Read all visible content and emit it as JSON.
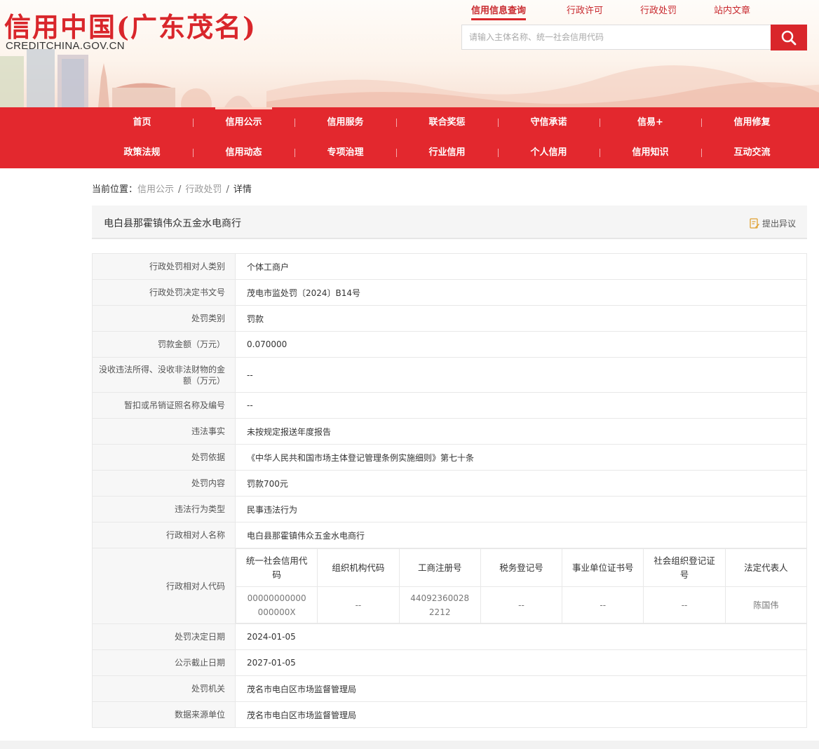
{
  "header": {
    "logo_title": "信用中国(广东茂名)",
    "logo_sub": "CREDITCHINA.GOV.CN",
    "top_links": [
      "信用信息查询",
      "行政许可",
      "行政处罚",
      "站内文章"
    ],
    "search_placeholder": "请输入主体名称、统一社会信用代码",
    "search_icon": "search-icon",
    "accent_color": "#d9262b"
  },
  "nav": {
    "row1": [
      "首页",
      "信用公示",
      "信用服务",
      "联合奖惩",
      "守信承诺",
      "信易+",
      "信用修复"
    ],
    "row2": [
      "政策法规",
      "信用动态",
      "专项治理",
      "行业信用",
      "个人信用",
      "信用知识",
      "互动交流"
    ],
    "active": "信用公示",
    "bg_color": "#e3282e"
  },
  "breadcrumb": {
    "prefix": "当前位置：",
    "items": [
      "信用公示",
      "行政处罚",
      "详情"
    ]
  },
  "title_bar": {
    "entity_name": "电白县那霍镇伟众五金水电商行",
    "objection_label": "提出异议",
    "objection_icon": "edit-icon"
  },
  "detail": {
    "rows": [
      {
        "label": "行政处罚相对人类别",
        "value": "个体工商户"
      },
      {
        "label": "行政处罚决定书文号",
        "value": "茂电市监处罚〔2024〕B14号"
      },
      {
        "label": "处罚类别",
        "value": "罚款"
      },
      {
        "label": "罚款金额（万元）",
        "value": "0.070000"
      },
      {
        "label": "没收违法所得、没收非法财物的金额（万元）",
        "value": "--"
      },
      {
        "label": "暂扣或吊销证照名称及编号",
        "value": "--"
      },
      {
        "label": "违法事实",
        "value": "未按规定报送年度报告"
      },
      {
        "label": "处罚依据",
        "value": "《中华人民共和国市场主体登记管理条例实施细则》第七十条"
      },
      {
        "label": "处罚内容",
        "value": "罚款700元"
      },
      {
        "label": "违法行为类型",
        "value": "民事违法行为"
      },
      {
        "label": "行政相对人名称",
        "value": "电白县那霍镇伟众五金水电商行"
      }
    ],
    "code_label": "行政相对人代码",
    "code_table": {
      "headers": [
        "统一社会信用代码",
        "组织机构代码",
        "工商注册号",
        "税务登记号",
        "事业单位证书号",
        "社会组织登记证号",
        "法定代表人"
      ],
      "values": [
        "00000000000000000X",
        "--",
        "440923600282212",
        "--",
        "--",
        "--",
        "陈国伟"
      ]
    },
    "rows_after": [
      {
        "label": "处罚决定日期",
        "value": "2024-01-05"
      },
      {
        "label": "公示截止日期",
        "value": "2027-01-05"
      },
      {
        "label": "处罚机关",
        "value": "茂名市电白区市场监督管理局"
      },
      {
        "label": "数据来源单位",
        "value": "茂名市电白区市场监督管理局"
      }
    ]
  }
}
